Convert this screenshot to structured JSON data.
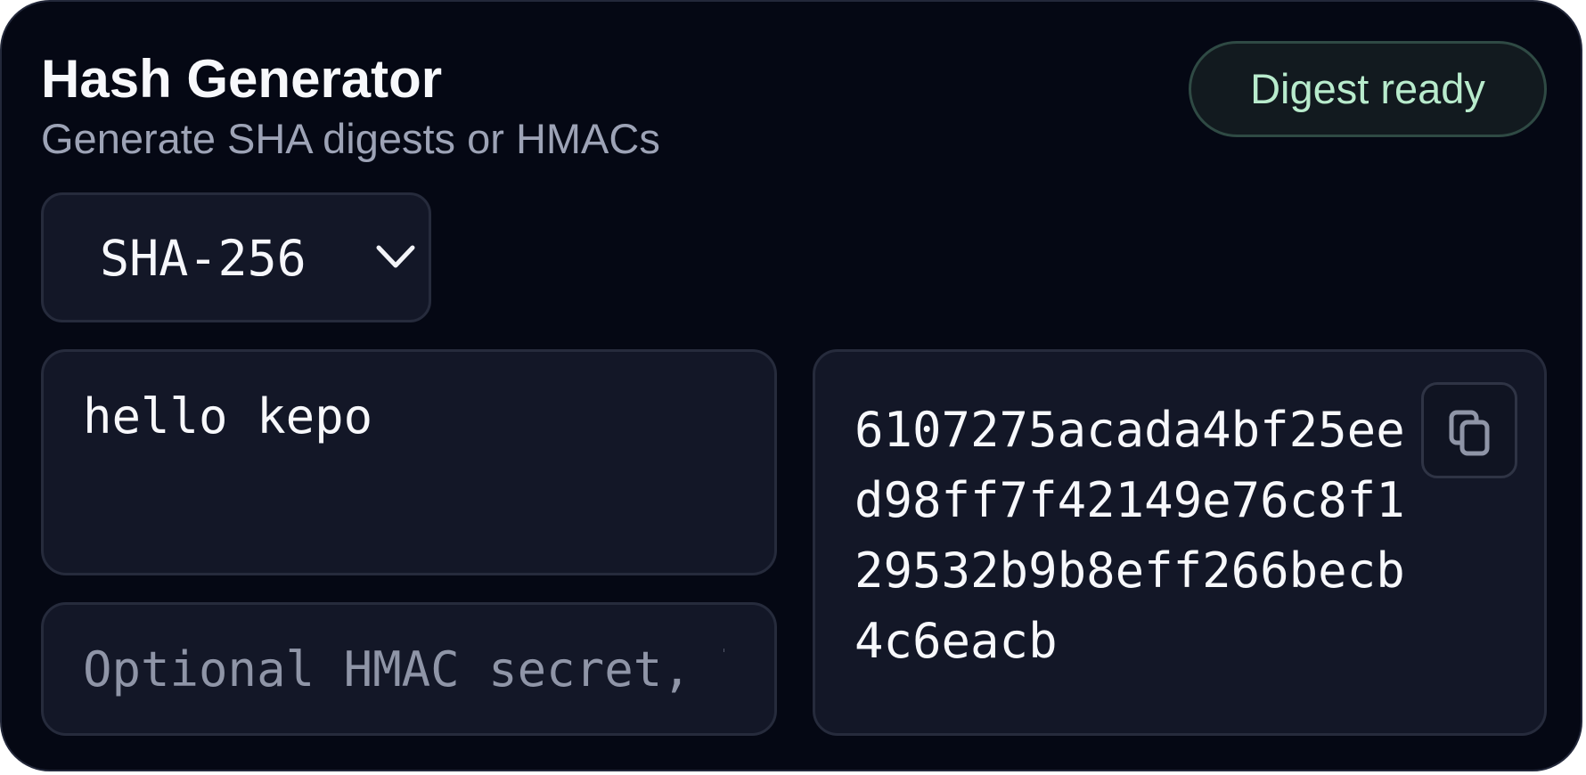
{
  "header": {
    "title": "Hash Generator",
    "subtitle": "Generate SHA digests or HMACs"
  },
  "status": {
    "label": "Digest ready",
    "color": "#b8ebcc"
  },
  "algorithm": {
    "selected": "SHA-256",
    "icon": "chevron-down-icon"
  },
  "message": {
    "value": "hello kepo"
  },
  "secret": {
    "placeholder": "Optional HMAC secret, l"
  },
  "output": {
    "digest": "6107275acada4bf25eed98ff7f42149e76c8f129532b9b8eff266becb4c6eacb",
    "copy_icon": "copy-icon"
  },
  "colors": {
    "background": "#050814",
    "panel": "#131727",
    "border": "#262b3c",
    "muted_text": "#9da3b6"
  }
}
